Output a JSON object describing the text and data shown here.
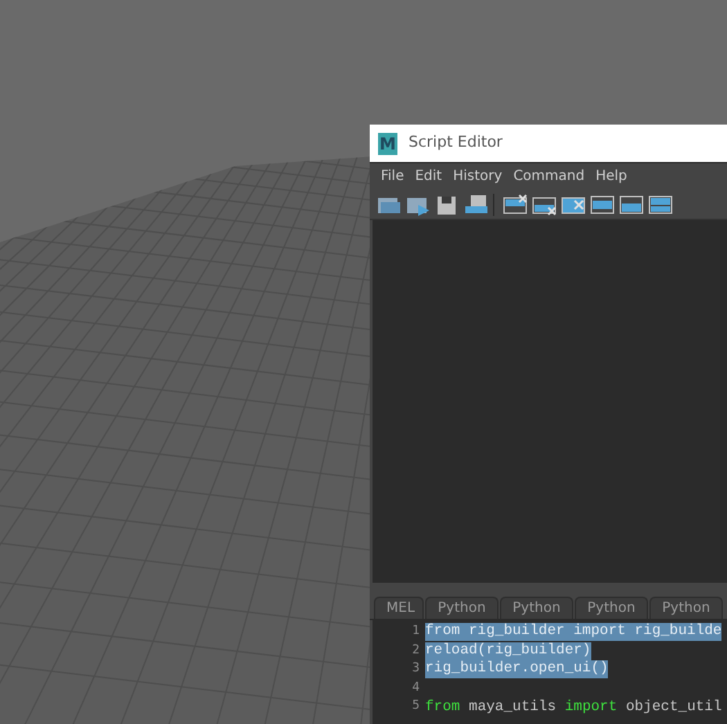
{
  "window": {
    "title": "Script Editor",
    "logo": "M"
  },
  "menu": [
    "File",
    "Edit",
    "History",
    "Command",
    "Help"
  ],
  "tabs": [
    {
      "label": "MEL",
      "selected": false
    },
    {
      "label": "Python",
      "selected": false
    },
    {
      "label": "Python",
      "selected": false
    },
    {
      "label": "Python",
      "selected": false
    },
    {
      "label": "Python",
      "selected": false
    }
  ],
  "code_lines": [
    {
      "number": "1",
      "selected": true,
      "text": "from rig_builder import rig_builde"
    },
    {
      "number": "2",
      "selected": true,
      "text": "reload(rig_builder)"
    },
    {
      "number": "3",
      "selected": true,
      "text": "rig_builder.open_ui()"
    },
    {
      "number": "4",
      "selected": false
    },
    {
      "number": "5",
      "selected": false,
      "tokens": [
        {
          "kind": "keyword",
          "text": "from"
        },
        {
          "kind": "text",
          "text": " maya_utils "
        },
        {
          "kind": "keyword",
          "text": "import"
        },
        {
          "kind": "text",
          "text": " object_util"
        }
      ]
    }
  ]
}
